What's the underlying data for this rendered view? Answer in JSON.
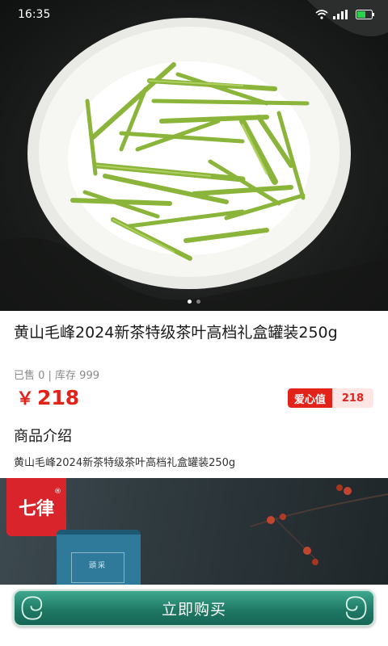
{
  "status_bar": {
    "time": "16:35",
    "icons": [
      "wifi-icon",
      "signal-icon",
      "battery-icon"
    ]
  },
  "gallery": {
    "image": "green-tea-leaves-on-white-plate",
    "page_count": 2,
    "active_index": 0
  },
  "product": {
    "title": "黄山毛峰2024新茶特级茶叶高档礼盒罐装250g",
    "sold_text": "已售 0 | 库存 999",
    "currency": "￥",
    "price": "218",
    "love_label": "爱心值",
    "love_value": "218"
  },
  "intro": {
    "heading": "商品介绍",
    "description": "黄山毛峰2024新茶特级茶叶高档礼盒罐装250g"
  },
  "detail_image": {
    "brand_logo_text": "七律",
    "tin_label": "頭采"
  },
  "action": {
    "buy_label": "立即购买"
  },
  "colors": {
    "price_red": "#e2231a",
    "buy_green": "#1f7a65"
  }
}
